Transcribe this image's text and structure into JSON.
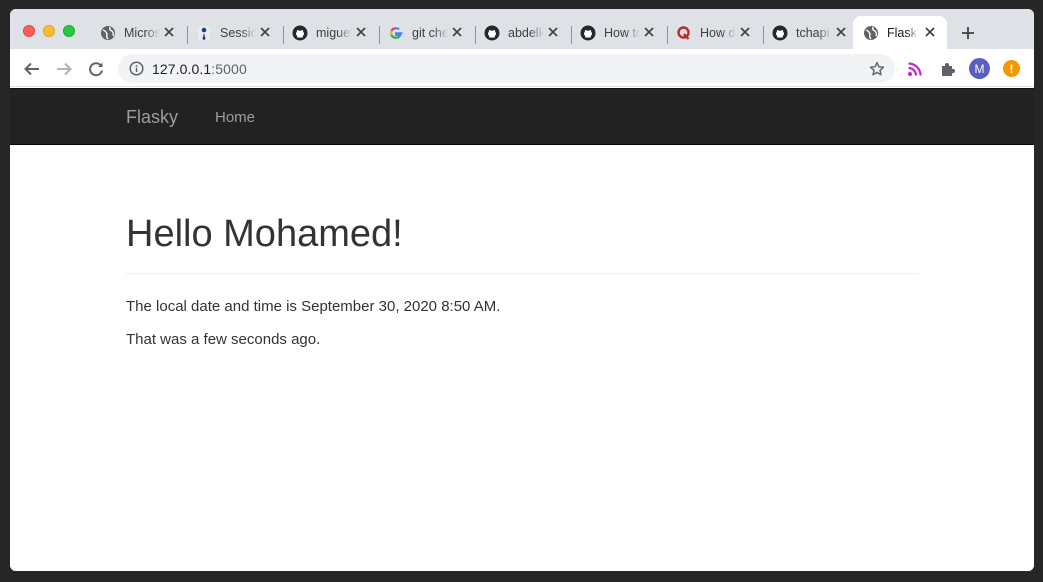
{
  "browser": {
    "tabs": [
      {
        "title": "Microsoft",
        "icon": "globe-icon",
        "active": false
      },
      {
        "title": "Sessions",
        "icon": "agent-icon",
        "active": false
      },
      {
        "title": "miguelgrinberg",
        "icon": "github-icon",
        "active": false
      },
      {
        "title": "git checkout",
        "icon": "google-icon",
        "active": false
      },
      {
        "title": "abdelkader",
        "icon": "github-icon",
        "active": false
      },
      {
        "title": "How to",
        "icon": "github-icon",
        "active": false
      },
      {
        "title": "How do",
        "icon": "quora-icon",
        "active": false
      },
      {
        "title": "tchapi",
        "icon": "github-icon",
        "active": false
      },
      {
        "title": "Flasky",
        "icon": "globe-icon",
        "active": true
      }
    ],
    "address": {
      "host": "127.0.0.1",
      "port": ":5000"
    },
    "profile_initial": "M",
    "alert_symbol": "!",
    "colors": {
      "avatar": "#5a5fbf",
      "alert": "#f29900",
      "feed_icon": "#c026d3"
    }
  },
  "navbar": {
    "brand": "Flasky",
    "links": [
      "Home"
    ]
  },
  "main": {
    "heading": "Hello Mohamed!",
    "line1": "The local date and time is September 30, 2020 8:50 AM.",
    "line2": "That was a few seconds ago."
  }
}
